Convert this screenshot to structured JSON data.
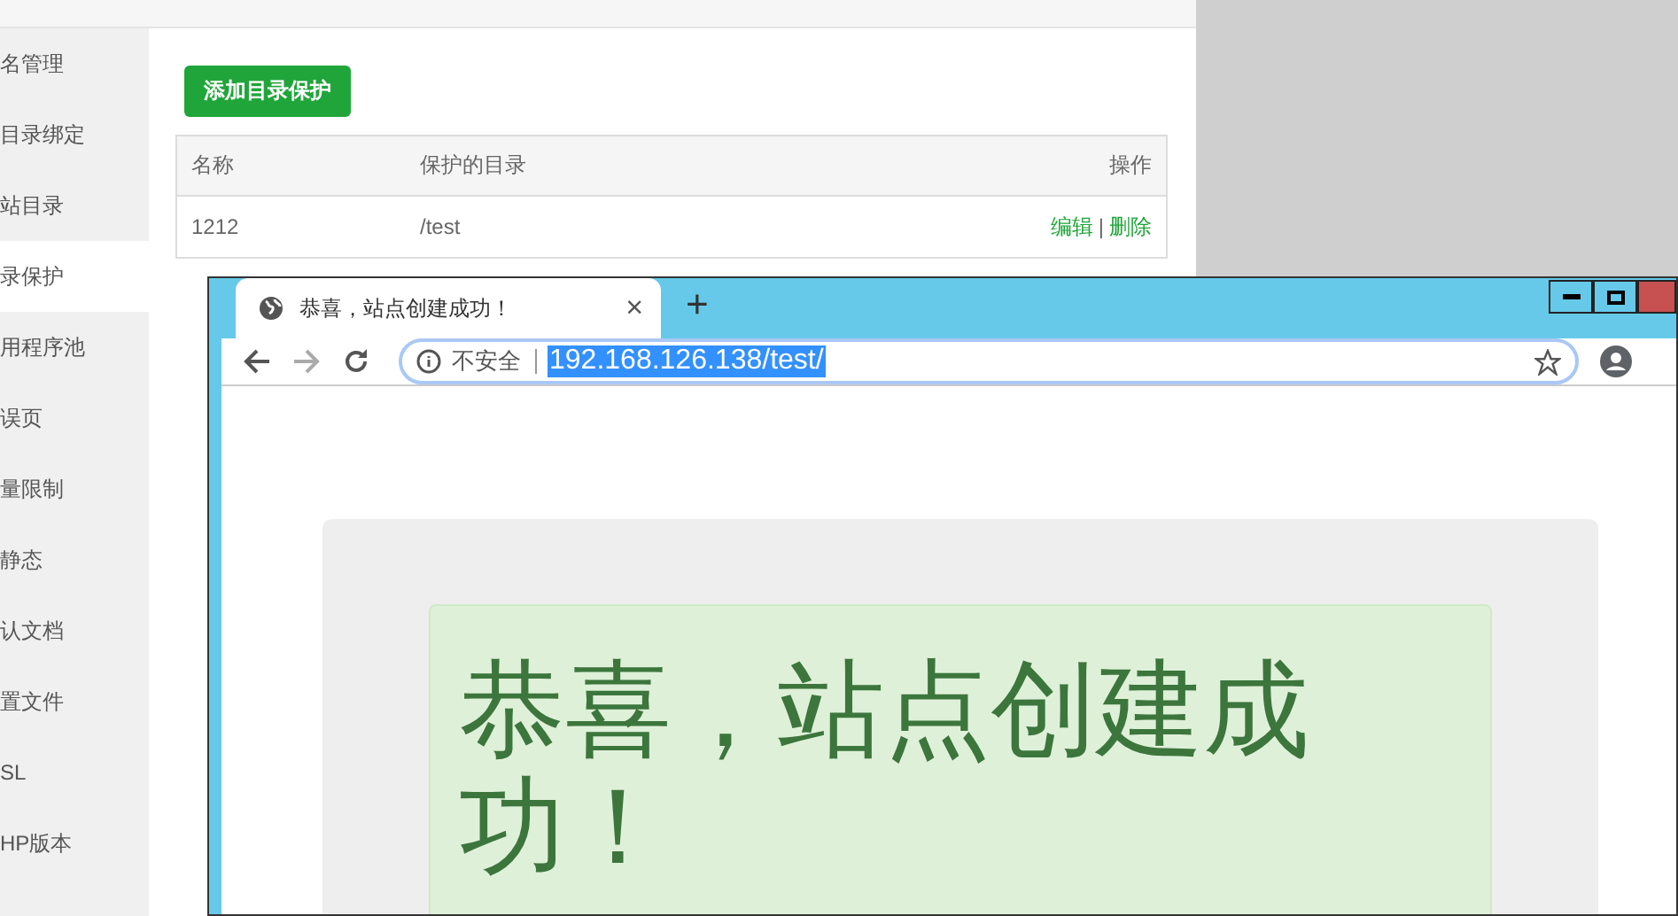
{
  "admin": {
    "sidebar": {
      "items": [
        {
          "label": "名管理",
          "selected": false
        },
        {
          "label": "目录绑定",
          "selected": false
        },
        {
          "label": "站目录",
          "selected": false
        },
        {
          "label": "录保护",
          "selected": true
        },
        {
          "label": "用程序池",
          "selected": false
        },
        {
          "label": "误页",
          "selected": false
        },
        {
          "label": "量限制",
          "selected": false
        },
        {
          "label": "静态",
          "selected": false
        },
        {
          "label": "认文档",
          "selected": false
        },
        {
          "label": "置文件",
          "selected": false
        },
        {
          "label": "SL",
          "selected": false
        },
        {
          "label": "HP版本",
          "selected": false
        }
      ]
    },
    "add_button": "添加目录保护",
    "table": {
      "columns": [
        "名称",
        "保护的目录",
        "操作"
      ],
      "rows": [
        {
          "name": "1212",
          "directory": "/test",
          "actions": [
            "编辑",
            "删除"
          ],
          "separator": "|"
        }
      ]
    }
  },
  "browser": {
    "tab": {
      "title": "恭喜，站点创建成功！",
      "close": "×"
    },
    "new_tab": "+",
    "address": {
      "security": "不安全",
      "url": "192.168.126.138/test/"
    },
    "page": {
      "heading": "恭喜，站点创建成功！"
    }
  }
}
